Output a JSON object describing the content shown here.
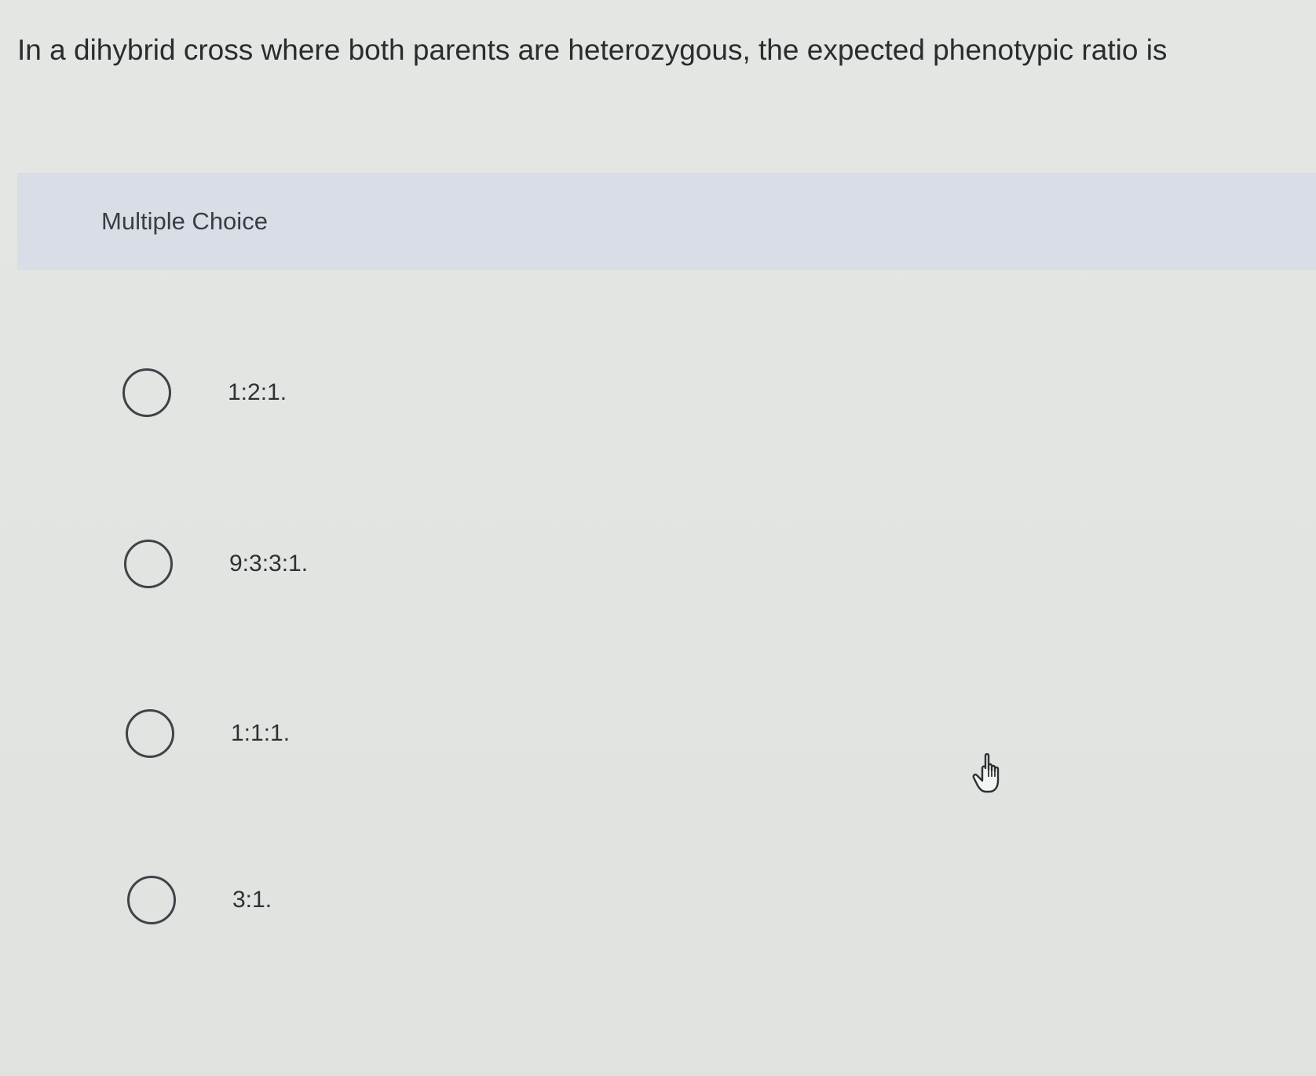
{
  "question": {
    "text": "In a dihybrid cross where both parents are heterozygous, the expected phenotypic ratio is"
  },
  "section": {
    "label": "Multiple Choice"
  },
  "choices": [
    {
      "label": "1:2:1."
    },
    {
      "label": "9:3:3:1."
    },
    {
      "label": "1:1:1."
    },
    {
      "label": "3:1."
    }
  ],
  "cursor": {
    "icon": "hand-pointer-icon"
  }
}
